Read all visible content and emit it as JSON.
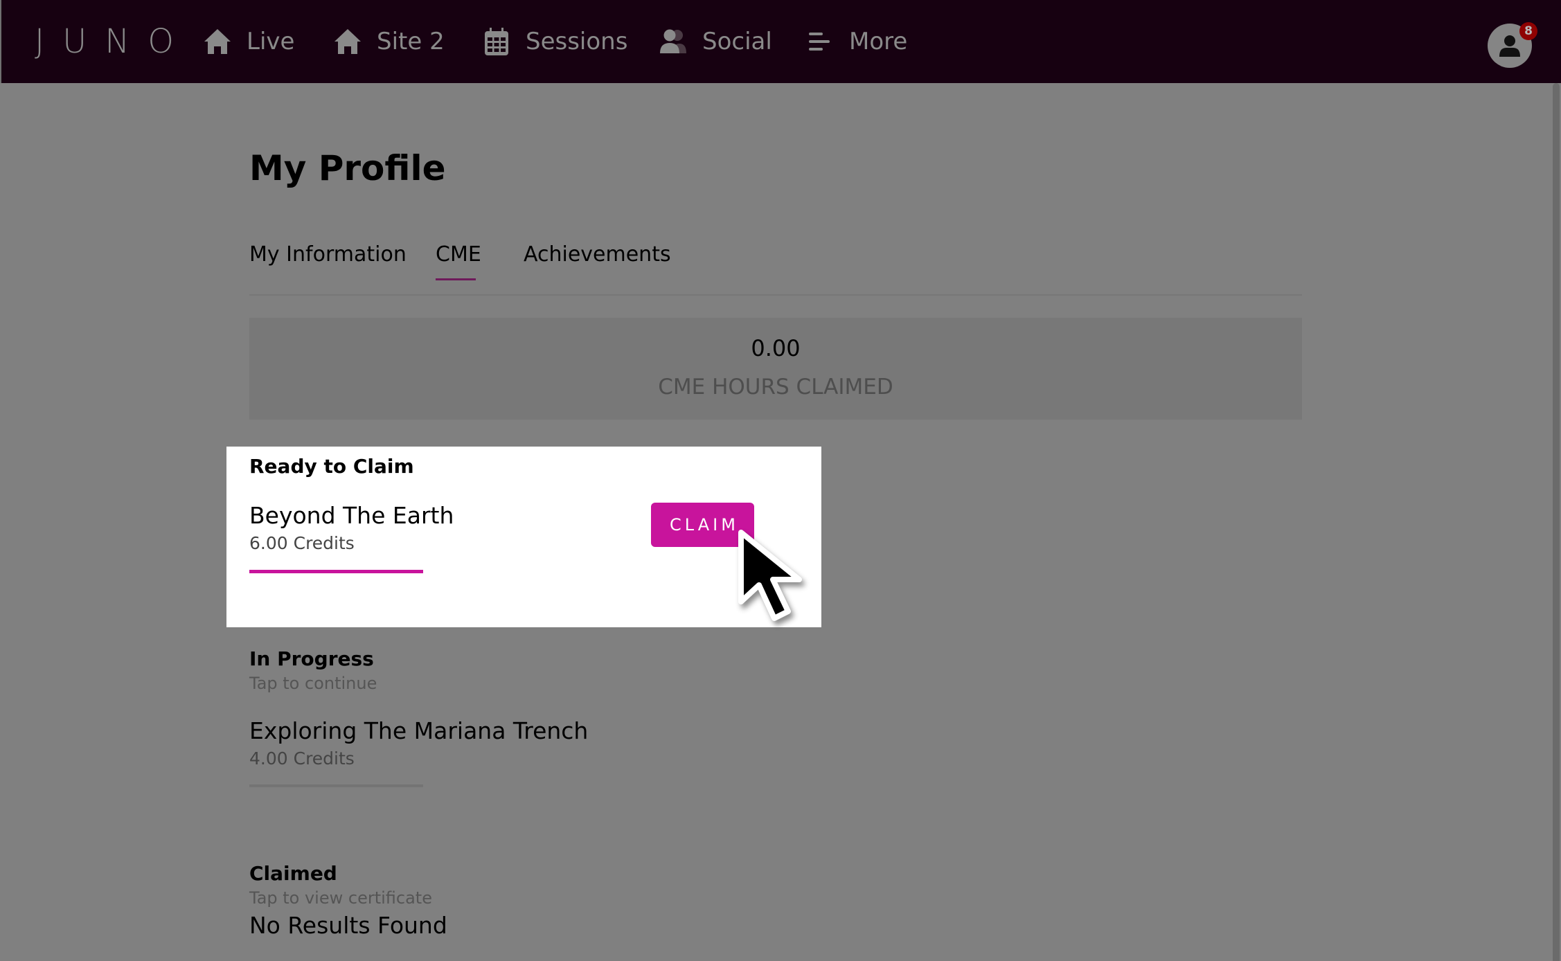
{
  "navbar": {
    "logo": "JUNO",
    "items": [
      {
        "label": "Live",
        "icon": "home-icon"
      },
      {
        "label": "Site 2",
        "icon": "home-icon"
      },
      {
        "label": "Sessions",
        "icon": "calendar-icon"
      },
      {
        "label": "Social",
        "icon": "users-icon"
      },
      {
        "label": "More",
        "icon": "menu-icon"
      }
    ],
    "avatar": {
      "icon": "user-icon",
      "notification_count": "8"
    }
  },
  "page": {
    "title": "My Profile",
    "tabs": [
      {
        "label": "My Information",
        "active": false
      },
      {
        "label": "CME",
        "active": true
      },
      {
        "label": "Achievements",
        "active": false
      }
    ]
  },
  "stats": {
    "value": "0.00",
    "label": "CME HOURS CLAIMED"
  },
  "ready_to_claim": {
    "heading": "Ready to Claim",
    "items": [
      {
        "title": "Beyond The Earth",
        "credits": "6.00 Credits",
        "progress": 1.0,
        "button_label": "CLAIM"
      }
    ]
  },
  "in_progress": {
    "heading": "In Progress",
    "subtitle": "Tap to continue",
    "items": [
      {
        "title": "Exploring The Mariana Trench",
        "credits": "4.00 Credits",
        "progress": 0.0
      }
    ]
  },
  "claimed": {
    "heading": "Claimed",
    "subtitle": "Tap to view certificate",
    "empty_message": "No Results Found"
  },
  "colors": {
    "accent": "#c8149c",
    "navbar_bg": "#170111",
    "tab_underline": "#6e1a5a",
    "badge": "#8f0202",
    "progress_track_empty": "#747474"
  }
}
